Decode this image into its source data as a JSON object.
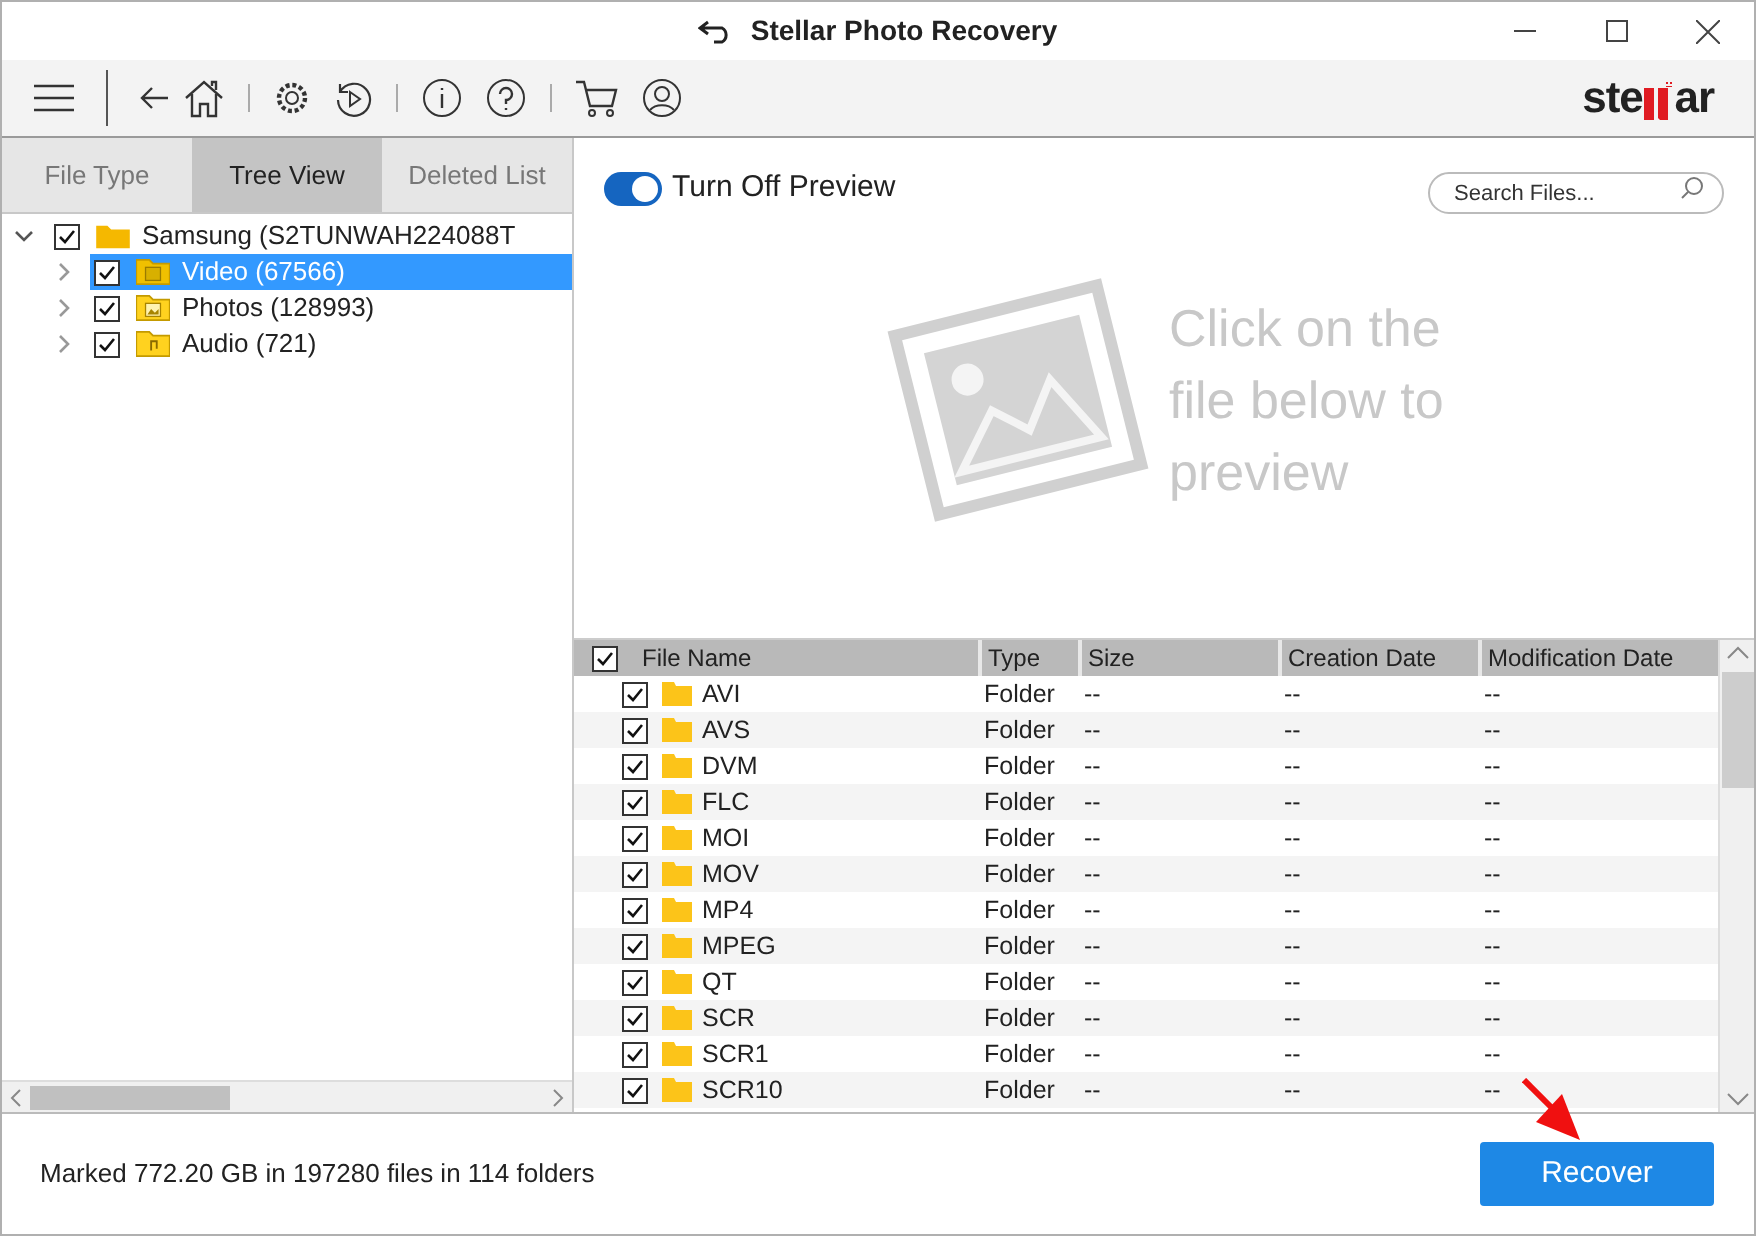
{
  "window": {
    "title": "Stellar Photo Recovery"
  },
  "logo": {
    "left": "ste",
    "right": "ar"
  },
  "tabs": [
    {
      "label": "File Type",
      "selected": false
    },
    {
      "label": "Tree View",
      "selected": true
    },
    {
      "label": "Deleted List",
      "selected": false
    }
  ],
  "tree": [
    {
      "label": "Samsung (S2TUNWAH224088T",
      "checked": true,
      "expanded": true,
      "selected": false,
      "kind": "drive",
      "children": [
        {
          "label": "Video (67566)",
          "checked": true,
          "expanded": false,
          "selected": true,
          "kind": "video"
        },
        {
          "label": "Photos (128993)",
          "checked": true,
          "expanded": false,
          "selected": false,
          "kind": "photo"
        },
        {
          "label": "Audio (721)",
          "checked": true,
          "expanded": false,
          "selected": false,
          "kind": "audio"
        }
      ]
    }
  ],
  "preview_toggle": {
    "label": "Turn Off Preview",
    "on": true
  },
  "search": {
    "placeholder": "Search Files..."
  },
  "preview_hint": "Click on the file below to preview",
  "table": {
    "all_checked": true,
    "columns": [
      "File Name",
      "Type",
      "Size",
      "Creation Date",
      "Modification Date"
    ],
    "rows": [
      {
        "checked": true,
        "cells": [
          "AVI",
          "Folder",
          "--",
          "--",
          "--"
        ]
      },
      {
        "checked": true,
        "cells": [
          "AVS",
          "Folder",
          "--",
          "--",
          "--"
        ]
      },
      {
        "checked": true,
        "cells": [
          "DVM",
          "Folder",
          "--",
          "--",
          "--"
        ]
      },
      {
        "checked": true,
        "cells": [
          "FLC",
          "Folder",
          "--",
          "--",
          "--"
        ]
      },
      {
        "checked": true,
        "cells": [
          "MOI",
          "Folder",
          "--",
          "--",
          "--"
        ]
      },
      {
        "checked": true,
        "cells": [
          "MOV",
          "Folder",
          "--",
          "--",
          "--"
        ]
      },
      {
        "checked": true,
        "cells": [
          "MP4",
          "Folder",
          "--",
          "--",
          "--"
        ]
      },
      {
        "checked": true,
        "cells": [
          "MPEG",
          "Folder",
          "--",
          "--",
          "--"
        ]
      },
      {
        "checked": true,
        "cells": [
          "QT",
          "Folder",
          "--",
          "--",
          "--"
        ]
      },
      {
        "checked": true,
        "cells": [
          "SCR",
          "Folder",
          "--",
          "--",
          "--"
        ]
      },
      {
        "checked": true,
        "cells": [
          "SCR1",
          "Folder",
          "--",
          "--",
          "--"
        ]
      },
      {
        "checked": true,
        "cells": [
          "SCR10",
          "Folder",
          "--",
          "--",
          "--"
        ]
      }
    ]
  },
  "status_bar": "Marked 772.20 GB in 197280 files in 114 folders",
  "recover_button": "Recover"
}
